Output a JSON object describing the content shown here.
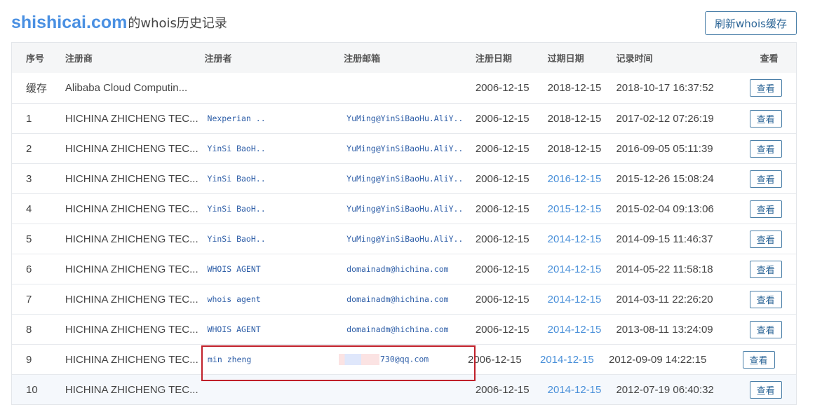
{
  "header": {
    "domain": "shishicai.com",
    "title_suffix": "的whois历史记录",
    "refresh_label": "刷新whois缓存"
  },
  "table": {
    "columns": [
      "序号",
      "注册商",
      "注册者",
      "注册邮箱",
      "注册日期",
      "过期日期",
      "记录时间",
      "查看"
    ],
    "rows": [
      {
        "idx": "缓存",
        "registrar": "Alibaba Cloud Computin...",
        "registrant": "",
        "email": "",
        "reg_date": "2006-12-15",
        "exp_date": "2018-12-15",
        "exp_highlight": false,
        "record_time": "2018-10-17 16:37:52",
        "view": "查看"
      },
      {
        "idx": "1",
        "registrar": "HICHINA ZHICHENG TEC...",
        "registrant": "Nexperian ..",
        "email": "YuMing@YinSiBaoHu.AliY..",
        "reg_date": "2006-12-15",
        "exp_date": "2018-12-15",
        "exp_highlight": false,
        "record_time": "2017-02-12 07:26:19",
        "view": "查看"
      },
      {
        "idx": "2",
        "registrar": "HICHINA ZHICHENG TEC...",
        "registrant": "YinSi BaoH..",
        "email": "YuMing@YinSiBaoHu.AliY..",
        "reg_date": "2006-12-15",
        "exp_date": "2018-12-15",
        "exp_highlight": false,
        "record_time": "2016-09-05 05:11:39",
        "view": "查看"
      },
      {
        "idx": "3",
        "registrar": "HICHINA ZHICHENG TEC...",
        "registrant": "YinSi BaoH..",
        "email": "YuMing@YinSiBaoHu.AliY..",
        "reg_date": "2006-12-15",
        "exp_date": "2016-12-15",
        "exp_highlight": true,
        "record_time": "2015-12-26 15:08:24",
        "view": "查看"
      },
      {
        "idx": "4",
        "registrar": "HICHINA ZHICHENG TEC...",
        "registrant": "YinSi BaoH..",
        "email": "YuMing@YinSiBaoHu.AliY..",
        "reg_date": "2006-12-15",
        "exp_date": "2015-12-15",
        "exp_highlight": true,
        "record_time": "2015-02-04 09:13:06",
        "view": "查看"
      },
      {
        "idx": "5",
        "registrar": "HICHINA ZHICHENG TEC...",
        "registrant": "YinSi BaoH..",
        "email": "YuMing@YinSiBaoHu.AliY..",
        "reg_date": "2006-12-15",
        "exp_date": "2014-12-15",
        "exp_highlight": true,
        "record_time": "2014-09-15 11:46:37",
        "view": "查看"
      },
      {
        "idx": "6",
        "registrar": "HICHINA ZHICHENG TEC...",
        "registrant": "WHOIS AGENT",
        "email": "domainadm@hichina.com",
        "reg_date": "2006-12-15",
        "exp_date": "2014-12-15",
        "exp_highlight": true,
        "record_time": "2014-05-22 11:58:18",
        "view": "查看"
      },
      {
        "idx": "7",
        "registrar": "HICHINA ZHICHENG TEC...",
        "registrant": "whois agent",
        "email": "domainadm@hichina.com",
        "reg_date": "2006-12-15",
        "exp_date": "2014-12-15",
        "exp_highlight": true,
        "record_time": "2014-03-11 22:26:20",
        "view": "查看"
      },
      {
        "idx": "8",
        "registrar": "HICHINA ZHICHENG TEC...",
        "registrant": "WHOIS AGENT",
        "email": "domainadm@hichina.com",
        "reg_date": "2006-12-15",
        "exp_date": "2014-12-15",
        "exp_highlight": true,
        "record_time": "2013-08-11 13:24:09",
        "view": "查看"
      },
      {
        "idx": "9",
        "registrar": "HICHINA ZHICHENG TEC...",
        "registrant": "min zheng",
        "email": "730@qq.com",
        "email_redacted": true,
        "reg_date": "2006-12-15",
        "exp_date": "2014-12-15",
        "exp_highlight": true,
        "record_time": "2012-09-09 14:22:15",
        "view": "查看"
      },
      {
        "idx": "10",
        "registrar": "HICHINA ZHICHENG TEC...",
        "registrant": "",
        "email": "",
        "reg_date": "2006-12-15",
        "exp_date": "2014-12-15",
        "exp_highlight": true,
        "record_time": "2012-07-19 06:40:32",
        "view": "查看"
      }
    ]
  },
  "colors": {
    "accent": "#4a90e2",
    "link_mono": "#2f5fa8",
    "date_highlight": "#4a90d9",
    "highlight_box": "#c0202a"
  }
}
